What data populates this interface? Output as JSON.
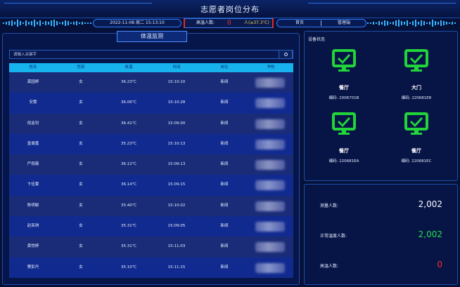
{
  "header": {
    "title": "志愿者岗位分布"
  },
  "status": {
    "datetime": "2022-11-08 周二 15:13:10",
    "high_temp_label": "高温人数:",
    "high_temp_value": "0",
    "threshold": "人(≥37.3℃)",
    "nav_home": "首页",
    "nav_manage": "管理端"
  },
  "left_panel": {
    "tab_title": "体温监测",
    "search_placeholder": "请输入关键字",
    "columns": [
      "姓名",
      "性别",
      "体温",
      "时间",
      "岗位",
      "学校"
    ],
    "rows": [
      {
        "name": "龚园婷",
        "gender": "女",
        "temp": "36.23℃",
        "time": "15:10:10",
        "post": "新闻"
      },
      {
        "name": "安雯",
        "gender": "女",
        "temp": "36.06℃",
        "time": "15:10:28",
        "post": "新闻"
      },
      {
        "name": "倪金钊",
        "gender": "女",
        "temp": "36.41℃",
        "time": "15:09:00",
        "post": "新闻"
      },
      {
        "name": "皇甫嘉",
        "gender": "女",
        "temp": "35.23℃",
        "time": "15:10:13",
        "post": "新闻"
      },
      {
        "name": "严雨薇",
        "gender": "女",
        "temp": "36.12℃",
        "time": "15:09:13",
        "post": "新闻"
      },
      {
        "name": "卞佳雯",
        "gender": "女",
        "temp": "36.14℃",
        "time": "15:09:15",
        "post": "新闻"
      },
      {
        "name": "陈明颖",
        "gender": "女",
        "temp": "35.40℃",
        "time": "15:10:02",
        "post": "新闻"
      },
      {
        "name": "赵英琪",
        "gender": "女",
        "temp": "35.31℃",
        "time": "15:09:05",
        "post": "新闻"
      },
      {
        "name": "黄悦婷",
        "gender": "女",
        "temp": "35.31℃",
        "time": "15:11:03",
        "post": "新闻"
      },
      {
        "name": "樊彭丹",
        "gender": "女",
        "temp": "35.10℃",
        "time": "15:11:15",
        "post": "新闻"
      }
    ]
  },
  "device_panel": {
    "title": "设备状态",
    "code_label": "编码:",
    "devices": [
      {
        "name": "餐厅",
        "code": "2006701B"
      },
      {
        "name": "大门",
        "code": "220681E8"
      },
      {
        "name": "餐厅",
        "code": "220681EA"
      },
      {
        "name": "餐厅",
        "code": "220681EC"
      }
    ],
    "ok_color": "#22d33a"
  },
  "stats": {
    "measured_label": "测量人数:",
    "measured_value": "2,002",
    "normal_label": "正常温度人数:",
    "normal_value": "2,002",
    "high_label": "高温人数:",
    "high_value": "0"
  }
}
